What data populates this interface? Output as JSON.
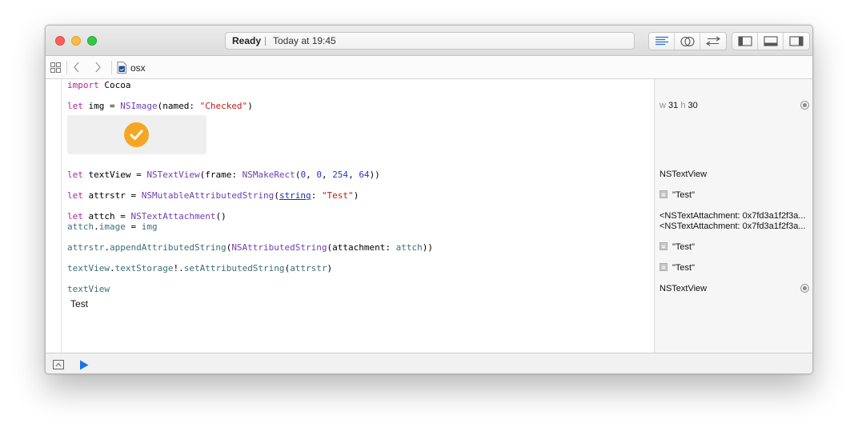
{
  "window": {
    "status": "Ready",
    "timestamp": "Today at 19:45"
  },
  "jumpbar": {
    "file_name": "osx"
  },
  "icons": {
    "close": "close-window-icon",
    "minimize": "minimize-window-icon",
    "zoom": "zoom-window-icon",
    "standard_editor": "standard-editor-icon",
    "assistant_editor": "assistant-editor-icon",
    "version_editor": "version-editor-icon",
    "navigator": "navigator-panel-icon",
    "debug_area": "debug-area-panel-icon",
    "utilities": "utilities-panel-icon",
    "related_items": "related-items-grid-icon",
    "back": "chevron-left-icon",
    "forward": "chevron-right-icon",
    "swift_file": "swift-file-icon",
    "quick_look": "quick-look-icon",
    "result_view": "show-result-icon",
    "hide_debug": "hide-debug-area-icon",
    "run": "run-playground-icon"
  },
  "code": {
    "line1": {
      "kw": "import",
      "rest": " Cocoa"
    },
    "line2": {
      "kw": "let",
      "a": " img = ",
      "ty": "NSImage",
      "b": "(named: ",
      "str": "\"Checked\"",
      "c": ")"
    },
    "line3": {
      "kw": "let",
      "a": " textView = ",
      "ty": "NSTextView",
      "b": "(frame: ",
      "fn": "NSMakeRect",
      "c": "(",
      "n1": "0",
      "s1": ", ",
      "n2": "0",
      "s2": ", ",
      "n3": "254",
      "s3": ", ",
      "n4": "64",
      "d": "))"
    },
    "line4": {
      "kw": "let",
      "a": " attrstr = ",
      "ty": "NSMutableAttributedString",
      "b": "(",
      "lnk": "string",
      "c": ": ",
      "str": "\"Test\"",
      "d": ")"
    },
    "line5": {
      "kw": "let",
      "a": " attch = ",
      "ty": "NSTextAttachment",
      "b": "()"
    },
    "line6": {
      "fn1": "attch",
      "a": ".",
      "fn2": "image",
      "b": " = ",
      "fn3": "img"
    },
    "line7": {
      "fn1": "attrstr",
      "a": ".",
      "fn2": "appendAttributedString",
      "b": "(",
      "ty": "NSAttributedString",
      "c": "(attachment: ",
      "fn3": "attch",
      "d": "))"
    },
    "line8": {
      "fn1": "textView",
      "a": ".",
      "fn2": "textStorage",
      "b": "!.",
      "fn3": "setAttributedString",
      "c": "(",
      "fn4": "attrstr",
      "d": ")"
    },
    "line9": {
      "fn1": "textView"
    },
    "textview_content": "Test"
  },
  "results": {
    "img": {
      "w_label": "w",
      "w": "31",
      "h_label": "h",
      "h": "30"
    },
    "textView": "NSTextView",
    "attrstr": "\"Test\"",
    "attch1": "<NSTextAttachment: 0x7fd3a1f2f3a...",
    "attch2": "<NSTextAttachment: 0x7fd3a1f2f3a...",
    "append": "\"Test\"",
    "set": "\"Test\"",
    "textView2": "NSTextView"
  },
  "colors": {
    "keyword": "#b0249a",
    "type": "#6e3fb2",
    "string": "#c41a16",
    "number": "#2734d7",
    "identifier": "#3e6d74",
    "checkmark": "#f5a623",
    "run_button": "#1a73e8"
  }
}
